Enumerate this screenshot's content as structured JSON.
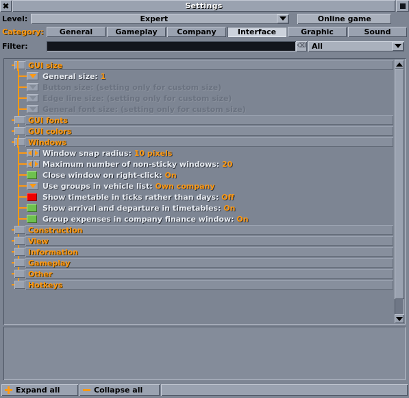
{
  "window": {
    "title": "Settings",
    "close_icon": "close-icon",
    "sticky_icon": "sticky-box-icon"
  },
  "level_row": {
    "label": "Level:",
    "selected": "Expert",
    "dropdown_icon": "chevron-down-icon",
    "online_game_label": "Online game"
  },
  "category_row": {
    "label": "Category:",
    "tabs": [
      {
        "label": "General",
        "selected": false
      },
      {
        "label": "Gameplay",
        "selected": false
      },
      {
        "label": "Company",
        "selected": false
      },
      {
        "label": "Interface",
        "selected": true
      },
      {
        "label": "Graphic",
        "selected": false
      },
      {
        "label": "Sound",
        "selected": false
      }
    ]
  },
  "filter_row": {
    "label": "Filter:",
    "value": "",
    "clear_icon": "clear-text-icon",
    "type_selected": "All",
    "dropdown_icon": "chevron-down-icon"
  },
  "settings_tree": [
    {
      "kind": "section",
      "label": "GUI size",
      "expanded": true,
      "depth": 0,
      "glyph": "expanded-node-icon"
    },
    {
      "kind": "entry",
      "depth": 1,
      "widget": "dropdown",
      "widget_state": "enabled",
      "label": "General size:",
      "value": "1",
      "disabled": false
    },
    {
      "kind": "entry",
      "depth": 1,
      "widget": "dropdown",
      "widget_state": "disabled",
      "label": "Button size:",
      "value": "(setting only for custom size)",
      "disabled": true
    },
    {
      "kind": "entry",
      "depth": 1,
      "widget": "dropdown",
      "widget_state": "disabled",
      "label": "Edge line size:",
      "value": "(setting only for custom size)",
      "disabled": true
    },
    {
      "kind": "entry",
      "depth": 1,
      "widget": "dropdown",
      "widget_state": "disabled",
      "label": "General font size:",
      "value": "(setting only for custom size)",
      "disabled": true
    },
    {
      "kind": "section",
      "label": "GUI fonts",
      "expanded": false,
      "depth": 0,
      "glyph": "collapsed-node-icon"
    },
    {
      "kind": "section",
      "label": "GUI colors",
      "expanded": false,
      "depth": 0,
      "glyph": "collapsed-node-icon"
    },
    {
      "kind": "section",
      "label": "Windows",
      "expanded": true,
      "depth": 0,
      "glyph": "expanded-node-icon"
    },
    {
      "kind": "entry",
      "depth": 1,
      "widget": "spinner",
      "widget_state": "enabled",
      "label": "Window snap radius:",
      "value": "10 pixels",
      "disabled": false
    },
    {
      "kind": "entry",
      "depth": 1,
      "widget": "spinner",
      "widget_state": "enabled",
      "label": "Maximum number of non-sticky windows:",
      "value": "20",
      "disabled": false
    },
    {
      "kind": "entry",
      "depth": 1,
      "widget": "checkbox-on",
      "widget_state": "enabled",
      "label": "Close window on right-click:",
      "value": "On",
      "disabled": false
    },
    {
      "kind": "entry",
      "depth": 1,
      "widget": "dropdown",
      "widget_state": "enabled",
      "label": "Use groups in vehicle list:",
      "value": "Own company",
      "disabled": false
    },
    {
      "kind": "entry",
      "depth": 1,
      "widget": "checkbox-off",
      "widget_state": "enabled",
      "label": "Show timetable in ticks rather than days:",
      "value": "Off",
      "disabled": false
    },
    {
      "kind": "entry",
      "depth": 1,
      "widget": "checkbox-on",
      "widget_state": "enabled",
      "label": "Show arrival and departure in timetables:",
      "value": "On",
      "disabled": false
    },
    {
      "kind": "entry",
      "depth": 1,
      "widget": "checkbox-on",
      "widget_state": "enabled",
      "label": "Group expenses in company finance window:",
      "value": "On",
      "disabled": false
    },
    {
      "kind": "section",
      "label": "Construction",
      "expanded": false,
      "depth": 0,
      "glyph": "collapsed-node-icon"
    },
    {
      "kind": "section",
      "label": "View",
      "expanded": false,
      "depth": 0,
      "glyph": "collapsed-node-icon"
    },
    {
      "kind": "section",
      "label": "Information",
      "expanded": false,
      "depth": 0,
      "glyph": "collapsed-node-icon"
    },
    {
      "kind": "section",
      "label": "Gameplay",
      "expanded": false,
      "depth": 0,
      "glyph": "collapsed-node-icon"
    },
    {
      "kind": "section",
      "label": "Other",
      "expanded": false,
      "depth": 0,
      "glyph": "collapsed-node-icon"
    },
    {
      "kind": "section",
      "label": "Hotkeys",
      "expanded": false,
      "depth": 0,
      "glyph": "collapsed-node-icon"
    }
  ],
  "scrollbar": {
    "up_icon": "scroll-up-arrow-icon",
    "down_icon": "scroll-down-arrow-icon"
  },
  "footer": {
    "expand_all_label": "Expand all",
    "collapse_all_label": "Collapse all",
    "expand_icon": "plus-icon",
    "collapse_icon": "minus-icon"
  },
  "colors": {
    "accent_orange": "#ff9912",
    "checkbox_on": "#6ec14e",
    "checkbox_off": "#ef0000",
    "window_bg": "#7d8593",
    "widget_face": "#9aa2b0"
  }
}
